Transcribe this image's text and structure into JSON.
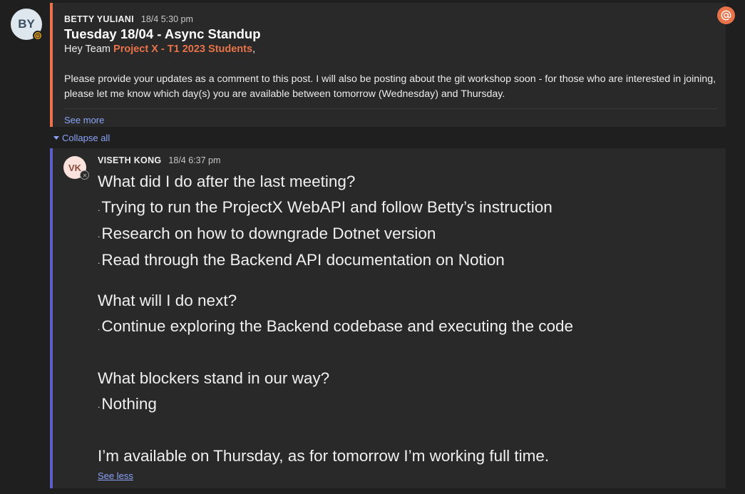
{
  "post": {
    "avatar_initials": "BY",
    "author": "BETTY YULIANI",
    "timestamp": "18/4 5:30 pm",
    "subject": "Tuesday 18/04 - Async Standup",
    "greeting_prefix": "Hey Team ",
    "mention": "Project X - T1 2023 Students",
    "greeting_suffix": ",",
    "body": "Please provide your updates as a comment to this post. I will also be posting about the git workshop soon - for those who are interested in joining, please let me know which day(s) you are available between tomorrow (Wednesday) and Thursday.",
    "see_more": "See more",
    "mention_badge_icon": "at-icon",
    "status_icon": "clock-icon"
  },
  "thread": {
    "collapse_label": "Collapse all"
  },
  "reply": {
    "avatar_initials": "VK",
    "author": "VISETH KONG",
    "timestamp": "18/4 6:37 pm",
    "q1": "What did I do after the last meeting?",
    "q1_items": [
      "Trying to run the ProjectX WebAPI and follow Betty’s instruction",
      "Research on how to downgrade Dotnet version",
      "Read through the Backend API documentation on Notion"
    ],
    "q2": "What will I do next?",
    "q2_items": [
      "Continue exploring the Backend codebase and executing the code"
    ],
    "q3": "What blockers stand in our way?",
    "q3_items": [
      "Nothing"
    ],
    "closing": "I’m available on Thursday, as for tomorrow I’m working full time.",
    "see_less": "See less",
    "bullet": "."
  },
  "colors": {
    "accent_orange": "#e8734a",
    "accent_purple": "#5b5fc7",
    "link_blue": "#8aa4f7",
    "away_yellow": "#e8a317"
  }
}
